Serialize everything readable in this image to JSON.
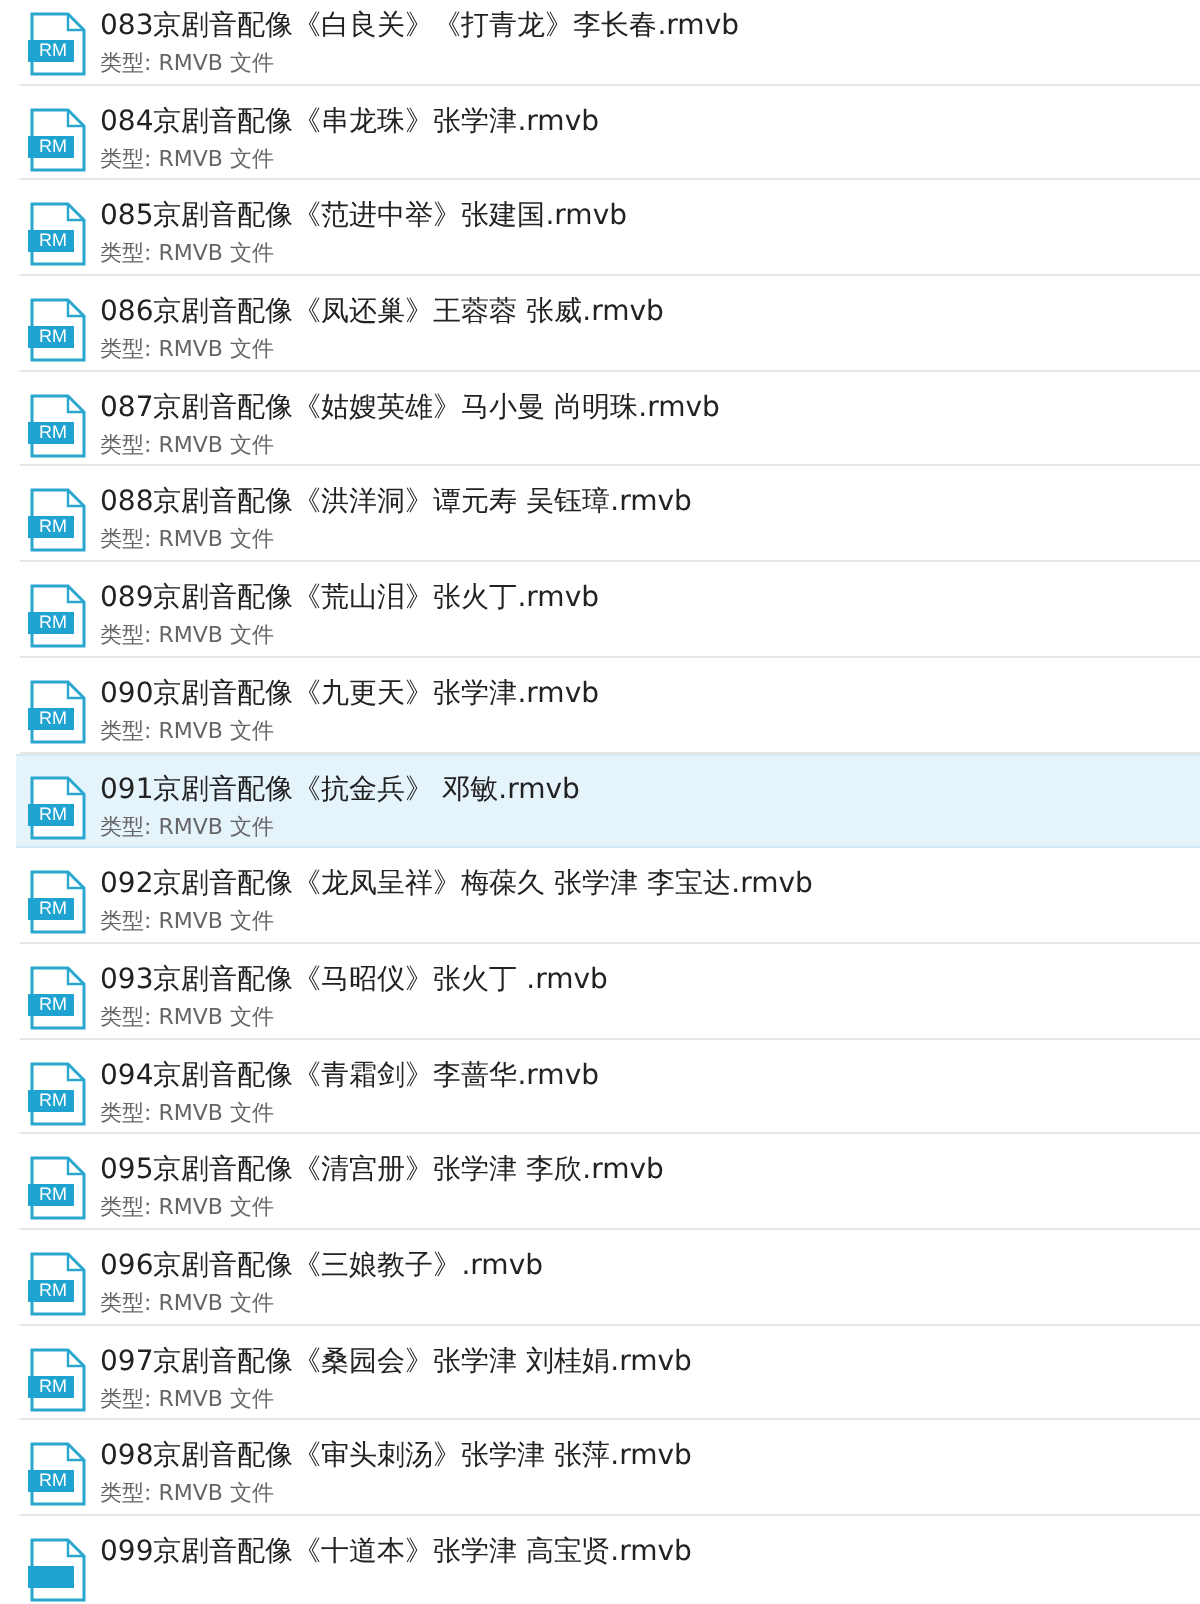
{
  "files": [
    {
      "name": "083京剧音配像《白良关》《打青龙》李长春.rmvb",
      "type": "类型: RMVB 文件",
      "icon_label": "RM",
      "selected": false
    },
    {
      "name": "084京剧音配像《串龙珠》张学津.rmvb",
      "type": "类型: RMVB 文件",
      "icon_label": "RM",
      "selected": false
    },
    {
      "name": "085京剧音配像《范进中举》张建国.rmvb",
      "type": "类型: RMVB 文件",
      "icon_label": "RM",
      "selected": false
    },
    {
      "name": "086京剧音配像《凤还巢》王蓉蓉 张威.rmvb",
      "type": "类型: RMVB 文件",
      "icon_label": "RM",
      "selected": false
    },
    {
      "name": "087京剧音配像《姑嫂英雄》马小曼 尚明珠.rmvb",
      "type": "类型: RMVB 文件",
      "icon_label": "RM",
      "selected": false
    },
    {
      "name": "088京剧音配像《洪洋洞》谭元寿 吴钰璋.rmvb",
      "type": "类型: RMVB 文件",
      "icon_label": "RM",
      "selected": false
    },
    {
      "name": "089京剧音配像《荒山泪》张火丁.rmvb",
      "type": "类型: RMVB 文件",
      "icon_label": "RM",
      "selected": false
    },
    {
      "name": "090京剧音配像《九更天》张学津.rmvb",
      "type": "类型: RMVB 文件",
      "icon_label": "RM",
      "selected": false
    },
    {
      "name": "091京剧音配像《抗金兵》 邓敏.rmvb",
      "type": "类型: RMVB 文件",
      "icon_label": "RM",
      "selected": true
    },
    {
      "name": "092京剧音配像《龙凤呈祥》梅葆久 张学津 李宝达.rmvb",
      "type": "类型: RMVB 文件",
      "icon_label": "RM",
      "selected": false
    },
    {
      "name": "093京剧音配像《马昭仪》张火丁 .rmvb",
      "type": "类型: RMVB 文件",
      "icon_label": "RM",
      "selected": false
    },
    {
      "name": "094京剧音配像《青霜剑》李蔷华.rmvb",
      "type": "类型: RMVB 文件",
      "icon_label": "RM",
      "selected": false
    },
    {
      "name": "095京剧音配像《清宫册》张学津 李欣.rmvb",
      "type": "类型: RMVB 文件",
      "icon_label": "RM",
      "selected": false
    },
    {
      "name": "096京剧音配像《三娘教子》.rmvb",
      "type": "类型: RMVB 文件",
      "icon_label": "RM",
      "selected": false
    },
    {
      "name": "097京剧音配像《桑园会》张学津 刘桂娟.rmvb",
      "type": "类型: RMVB 文件",
      "icon_label": "RM",
      "selected": false
    },
    {
      "name": "098京剧音配像《审头刺汤》张学津 张萍.rmvb",
      "type": "类型: RMVB 文件",
      "icon_label": "RM",
      "selected": false
    },
    {
      "name": "099京剧音配像《十道本》张学津 高宝贤.rmvb",
      "selected": false
    }
  ]
}
